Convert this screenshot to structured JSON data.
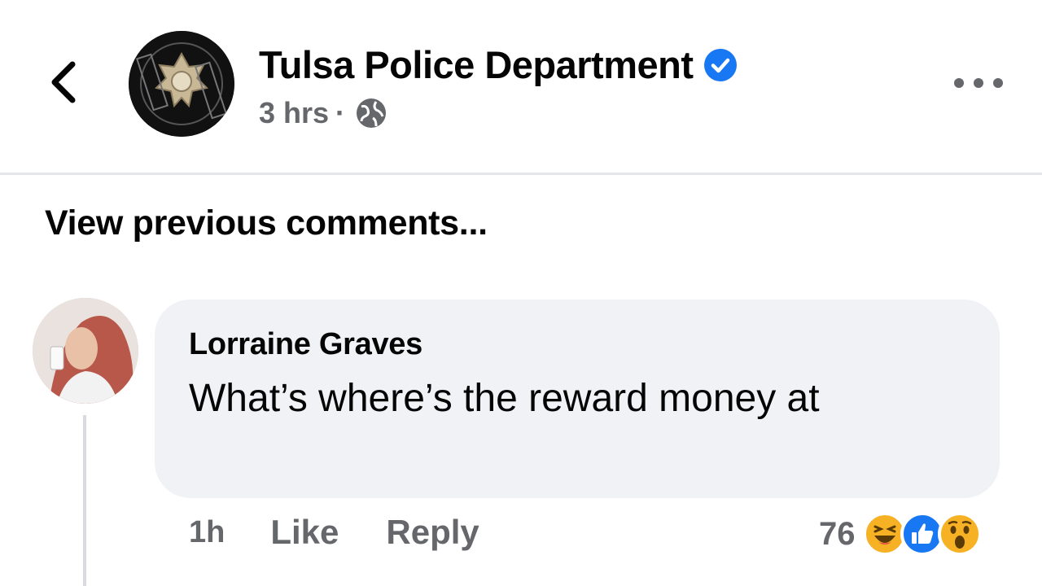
{
  "post": {
    "page_name": "Tulsa Police Department",
    "time": "3 hrs",
    "separator": "·",
    "audience_icon": "globe-icon",
    "verified_icon": "verified-badge-icon",
    "verified_color": "#1877f2"
  },
  "comments": {
    "view_previous": "View previous comments..."
  },
  "comment": {
    "author": "Lorraine Graves",
    "text": "What’s where’s the reward money at",
    "time": "1h",
    "like_label": "Like",
    "reply_label": "Reply",
    "reaction_count": "76",
    "reactions": [
      "haha-icon",
      "like-icon",
      "wow-icon"
    ]
  }
}
